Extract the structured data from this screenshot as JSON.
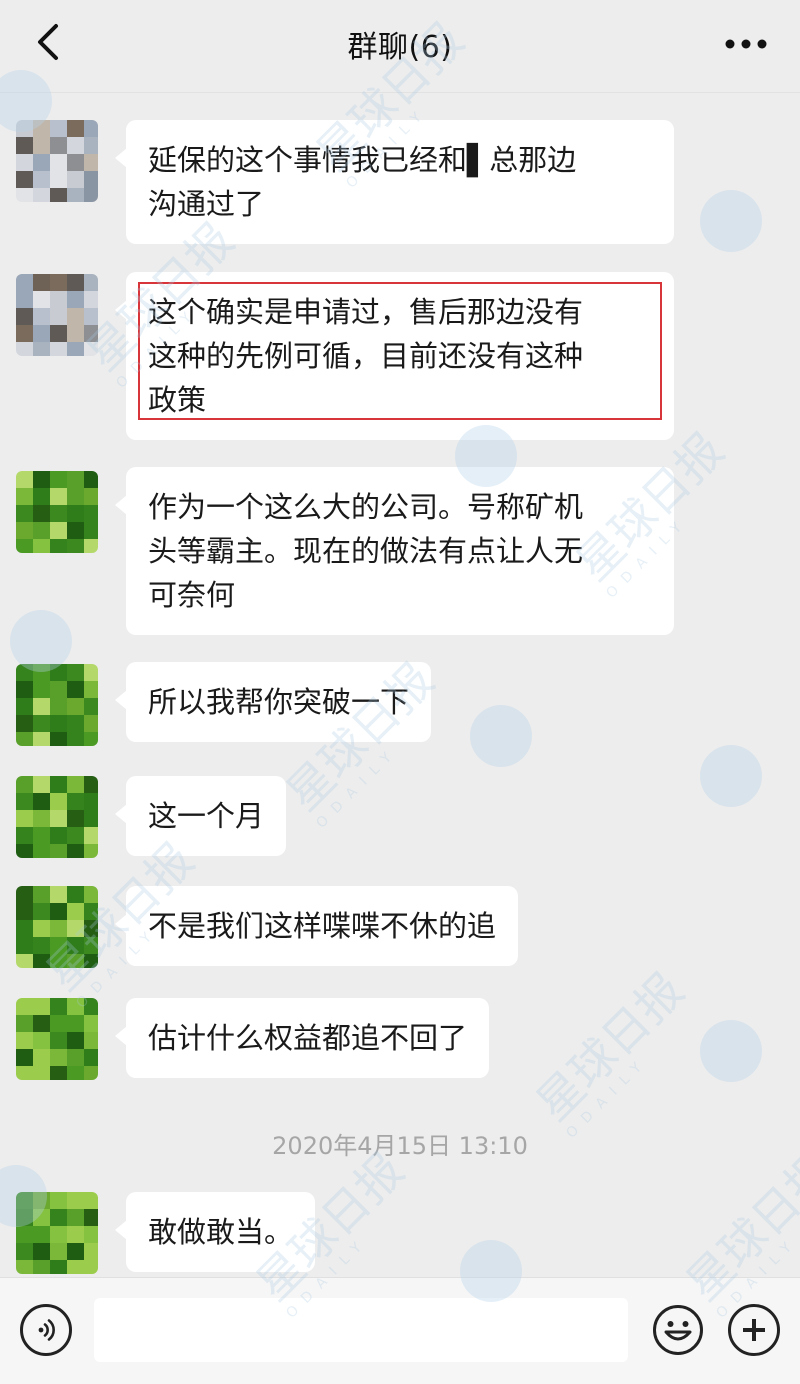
{
  "header": {
    "title": "群聊(6)",
    "back_icon": "chevron-left-icon",
    "more_icon": "more-dots-icon"
  },
  "messages": [
    {
      "text": "延保的这个事情我已经和█总那边沟通过了",
      "lines": [
        "延保的这个事情我已经和▌总那边",
        "沟通过了"
      ],
      "avatar_style": "blurred-photo-gray",
      "highlighted": false
    },
    {
      "text": "这个确实是申请过，售后那边没有这种的先例可循，目前还没有这种政策",
      "lines": [
        "这个确实是申请过，售后那边没有",
        "这种的先例可循，目前还没有这种",
        "政策"
      ],
      "avatar_style": "blurred-photo-gray",
      "highlighted": true
    },
    {
      "text": "作为一个这么大的公司。号称矿机头等霸主。现在的做法有点让人无可奈何",
      "lines": [
        "作为一个这么大的公司。号称矿机",
        "头等霸主。现在的做法有点让人无",
        "可奈何"
      ],
      "avatar_style": "pixelated-green",
      "highlighted": false
    },
    {
      "text": "所以我帮你突破一下",
      "lines": [
        "所以我帮你突破一下"
      ],
      "avatar_style": "pixelated-green",
      "highlighted": false
    },
    {
      "text": "这一个月",
      "lines": [
        "这一个月"
      ],
      "avatar_style": "pixelated-green",
      "highlighted": false
    },
    {
      "text": "不是我们这样喋喋不休的追",
      "lines": [
        "不是我们这样喋喋不休的追"
      ],
      "avatar_style": "pixelated-green",
      "highlighted": false
    },
    {
      "text": "估计什么权益都追不回了",
      "lines": [
        "估计什么权益都追不回了"
      ],
      "avatar_style": "pixelated-green",
      "highlighted": false
    },
    {
      "text": "敢做敢当。",
      "lines": [
        "敢做敢当。"
      ],
      "avatar_style": "pixelated-green",
      "highlighted": false
    }
  ],
  "timestamp": "2020年4月15日 13:10",
  "watermark": {
    "text": "星球日报",
    "sub": "ODAILY"
  },
  "input_bar": {
    "voice_icon": "voice-icon",
    "input_value": "",
    "emoji_icon": "emoji-icon",
    "plus_icon": "plus-icon"
  },
  "colors": {
    "background": "#ededed",
    "bubble": "#ffffff",
    "highlight_border": "#d8353b",
    "timestamp": "#a6a6a6"
  }
}
